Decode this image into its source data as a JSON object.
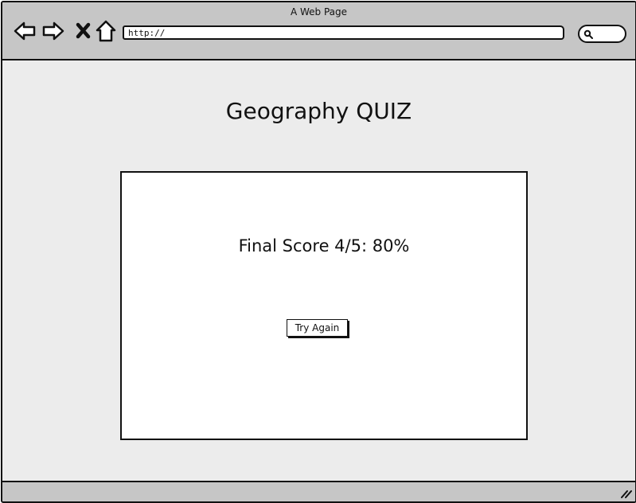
{
  "window": {
    "title": "A Web Page"
  },
  "toolbar": {
    "icons": [
      "back-arrow-icon",
      "forward-arrow-icon",
      "close-x-icon",
      "home-icon"
    ],
    "url": "http://",
    "search_icon": "search-icon"
  },
  "page": {
    "title": "Geography QUIZ",
    "score_text": "Final Score 4/5: 80%",
    "try_again_label": "Try Again"
  },
  "score": {
    "correct": 4,
    "total": 5,
    "percent": 80
  },
  "colors": {
    "chrome": "#c6c6c6",
    "page_background": "#ececec",
    "panel": "#ffffff",
    "ink": "#111111"
  }
}
